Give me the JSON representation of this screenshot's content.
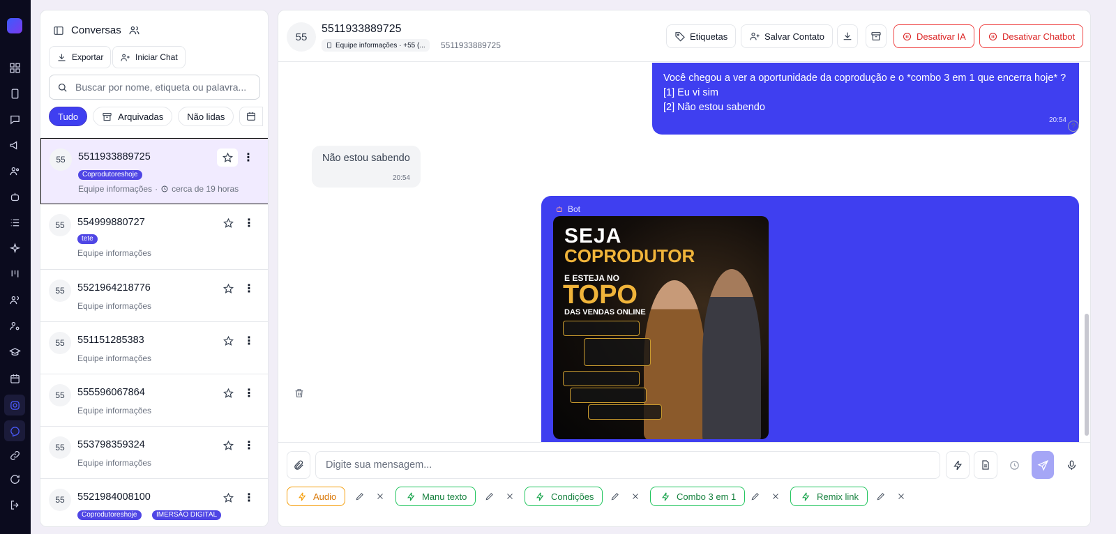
{
  "sidebar_panel": {
    "title": "Conversas",
    "export_label": "Exportar",
    "start_chat_label": "Iniciar Chat",
    "search_placeholder": "Buscar por nome, etiqueta ou palavra...",
    "filters": [
      "Tudo",
      "Arquivadas",
      "Não lidas"
    ]
  },
  "conversations": [
    {
      "avatar": "55",
      "number": "5511933889725",
      "tags": [
        "Coprodutoreshoje"
      ],
      "team": "Equipe informações",
      "time": "cerca de 19 horas"
    },
    {
      "avatar": "55",
      "number": "554999880727",
      "tags": [
        "tete"
      ],
      "team": "Equipe informações"
    },
    {
      "avatar": "55",
      "number": "5521964218776",
      "team": "Equipe informações"
    },
    {
      "avatar": "55",
      "number": "551151285383",
      "team": "Equipe informações"
    },
    {
      "avatar": "55",
      "number": "555596067864",
      "team": "Equipe informações"
    },
    {
      "avatar": "55",
      "number": "553798359324",
      "team": "Equipe informações"
    },
    {
      "avatar": "55",
      "number": "5521984008100",
      "tags": [
        "Coprodutoreshoje",
        "IMERSÃO DIGITAL"
      ]
    }
  ],
  "chat": {
    "avatar": "55",
    "name": "5511933889725",
    "team_pill": "Equipe informações · +55 (...",
    "number": "5511933889725",
    "buttons": {
      "tags": "Etiquetas",
      "save_contact": "Salvar Contato",
      "disable_ai": "Desativar IA",
      "disable_chatbot": "Desativar Chatbot"
    },
    "messages": {
      "out1_lines": [
        "Você chegou a ver a oportunidade da coprodução e o *combo 3 em 1 que encerra hoje* ?",
        "[1] Eu vi sim",
        "[2] Não estou sabendo"
      ],
      "out1_time": "20:54",
      "in1_text": "Não estou sabendo",
      "in1_time": "20:54",
      "bot_label": "Bot",
      "promo": {
        "line1": "SEJA",
        "line2": "COPRODUTOR",
        "line3": "E ESTEJA NO",
        "line4": "TOPO",
        "line5": "DAS VENDAS ONLINE"
      }
    },
    "composer_placeholder": "Digite sua mensagem...",
    "quick_replies": [
      "Audio",
      "Manu texto",
      "Condições",
      "Combo 3 em 1",
      "Remix link"
    ]
  },
  "colors": {
    "accent": "#3f3ff0",
    "danger": "#dc2626",
    "quick_reply_green": "#15803d",
    "quick_reply_orange": "#d97706",
    "rail": "#0b0b1e"
  }
}
